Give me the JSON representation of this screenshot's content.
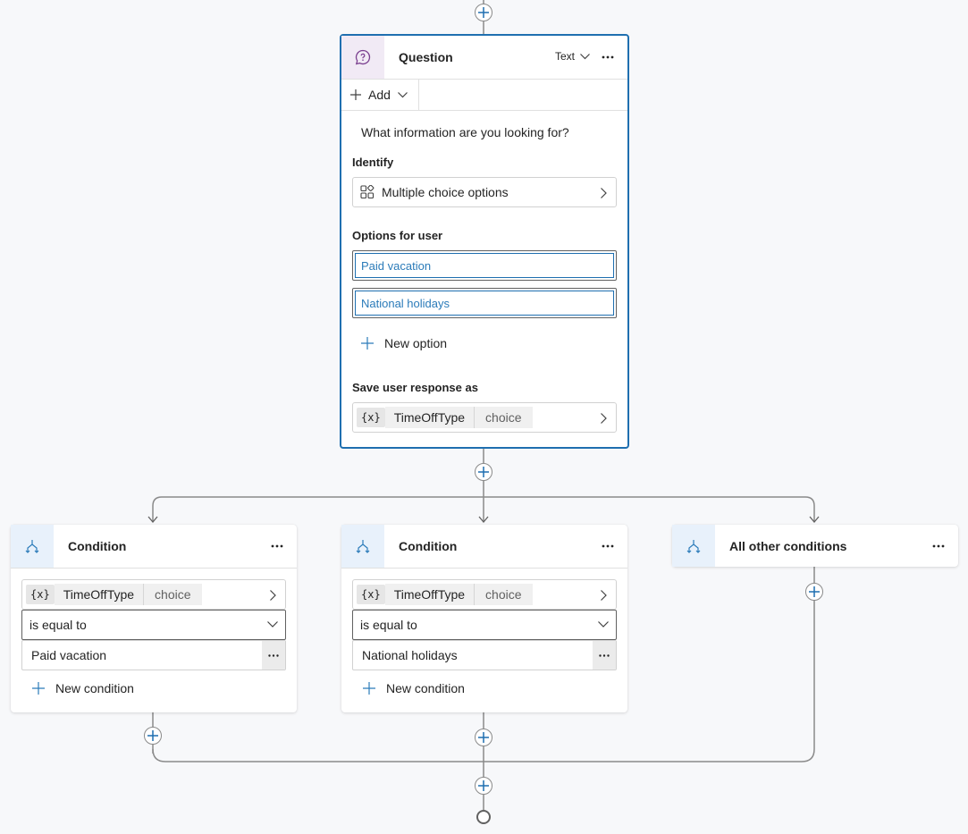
{
  "question_card": {
    "title": "Question",
    "icon": "chat-question-icon",
    "type_selector": "Text",
    "add_label": "Add",
    "prompt": "What information are you looking for?",
    "identify_label": "Identify",
    "identify_value": "Multiple choice options",
    "identify_icon": "apps-icon",
    "options_label": "Options for user",
    "options": [
      "Paid vacation",
      "National holidays"
    ],
    "new_option_label": "New option",
    "save_label": "Save user response as",
    "variable": {
      "prefix": "{x}",
      "name": "TimeOffType",
      "type": "choice"
    }
  },
  "conditions": [
    {
      "title": "Condition",
      "variable": {
        "prefix": "{x}",
        "name": "TimeOffType",
        "type": "choice"
      },
      "operator": "is equal to",
      "value": "Paid vacation",
      "new_condition_label": "New condition"
    },
    {
      "title": "Condition",
      "variable": {
        "prefix": "{x}",
        "name": "TimeOffType",
        "type": "choice"
      },
      "operator": "is equal to",
      "value": "National holidays",
      "new_condition_label": "New condition"
    }
  ],
  "else_card": {
    "title": "All other conditions"
  },
  "colors": {
    "accent": "#1f6fb0",
    "question_icon_bg": "#f1eaf5",
    "question_icon": "#7a3f8f",
    "condition_icon_bg": "#e8f1fb",
    "condition_icon": "#2b7bb9",
    "connector": "#8a8a8a",
    "background": "#f7f8fa"
  }
}
